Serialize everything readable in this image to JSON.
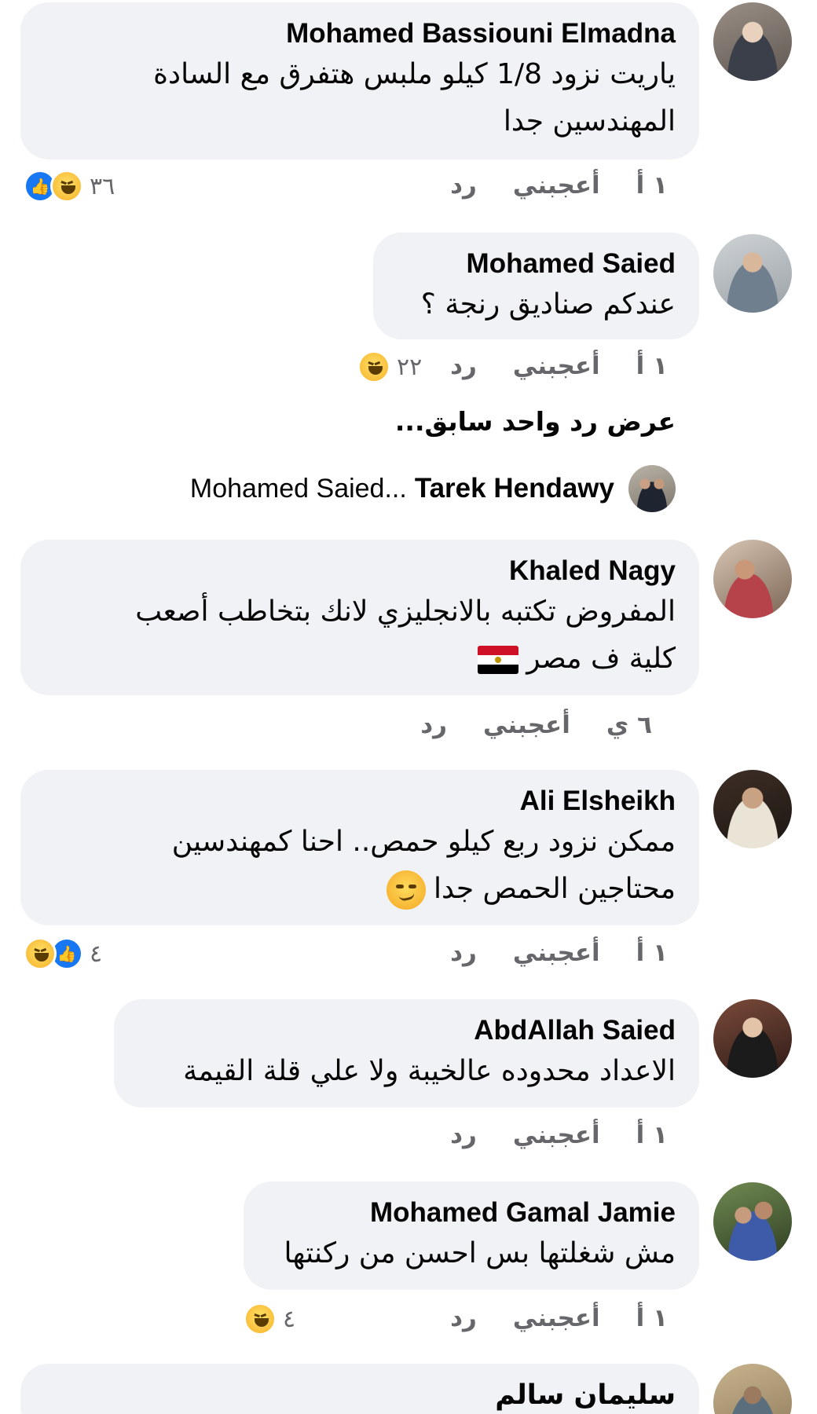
{
  "actions": {
    "like": "أعجبني",
    "reply": "رد"
  },
  "comments": [
    {
      "author": "Mohamed Bassiouni Elmadna",
      "lines": [
        "ياريت نزود 1/8 كيلو ملبس هتفرق مع السادة",
        "المهندسين جدا"
      ],
      "time": "١ أ",
      "reactions": [
        "like",
        "haha"
      ],
      "reaction_count": "٣٦"
    },
    {
      "author": "Mohamed Saied",
      "lines": [
        "عندكم صناديق رنجة ؟"
      ],
      "time": "١ أ",
      "reactions": [
        "haha"
      ],
      "reaction_count": "٢٢"
    },
    {
      "author": "Khaled Nagy",
      "lines": [
        "المفروض تكتبه بالانجليزي لانك بتخاطب أصعب",
        "كلية ف مصر"
      ],
      "time": "٦ ي",
      "reactions": [],
      "reaction_count": ""
    },
    {
      "author": "Ali Elsheikh",
      "lines": [
        "ممكن نزود ربع كيلو حمص.. احنا كمهندسين",
        "محتاجين الحمص جدا"
      ],
      "time": "١ أ",
      "reactions": [
        "haha",
        "like"
      ],
      "reaction_count": "٤"
    },
    {
      "author": "AbdAllah Saied",
      "lines": [
        "الاعداد محدوده عالخيبة ولا علي قلة القيمة"
      ],
      "time": "١ أ",
      "reactions": [],
      "reaction_count": ""
    },
    {
      "author": "Mohamed Gamal Jamie",
      "lines": [
        "مش شغلتها بس احسن من ركنتها"
      ],
      "time": "١ أ",
      "reactions": [
        "haha"
      ],
      "reaction_count": "٤"
    },
    {
      "author": "سليمان سالم",
      "lines": [],
      "time": "",
      "reactions": [],
      "reaction_count": ""
    }
  ],
  "view_previous_reply": "عرض رد واحد سابق...",
  "reply_preview": {
    "author": "Tarek Hendawy",
    "text": "Mohamed Saied..."
  },
  "icons": {
    "like": "thumbs-up-icon",
    "haha": "haha-emoji-icon",
    "smirk": "smirk-emoji-icon",
    "flag": "egypt-flag-icon"
  },
  "colors": {
    "bubble": "#f0f2f5",
    "meta": "#65676b",
    "like_blue": "#1877f2"
  }
}
